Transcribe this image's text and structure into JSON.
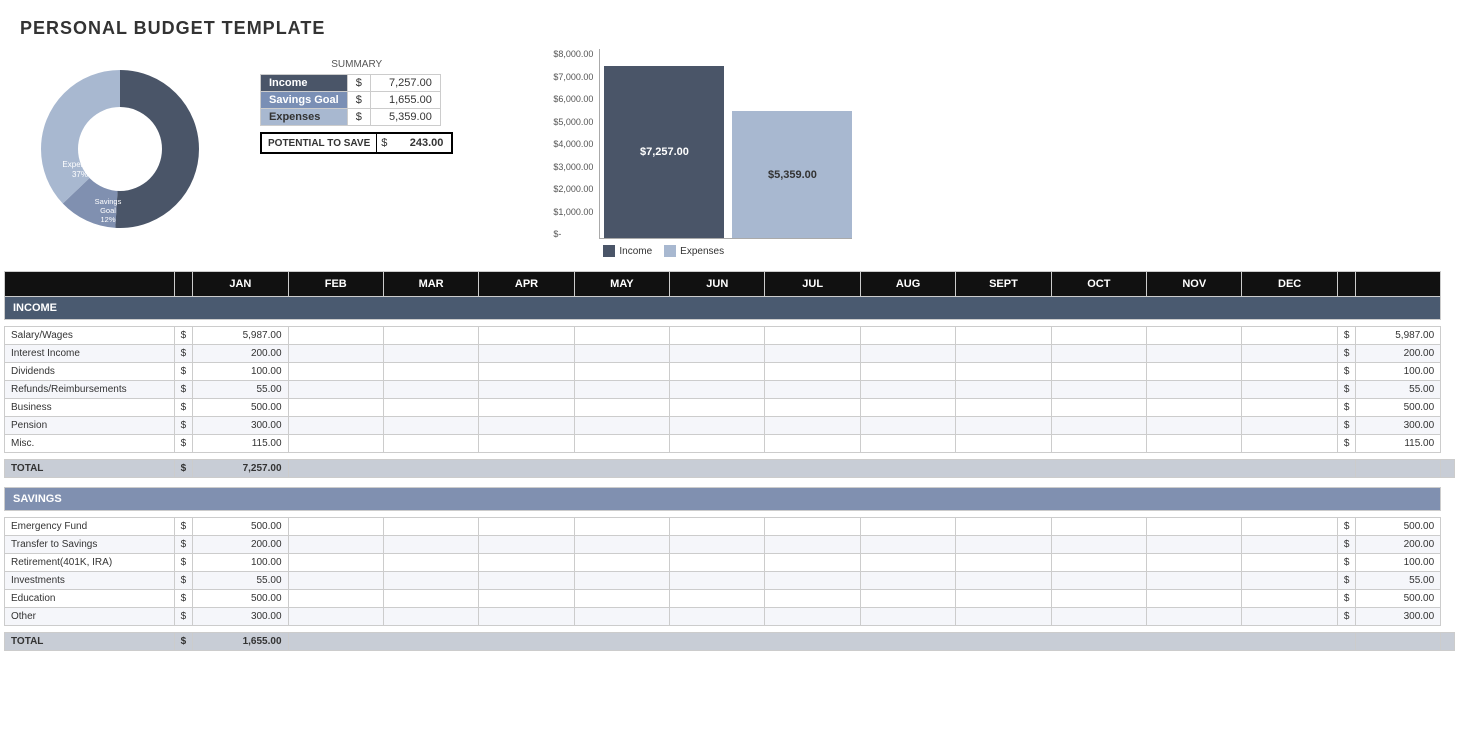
{
  "title": "PERSONAL BUDGET TEMPLATE",
  "summary": {
    "title": "SUMMARY",
    "rows": [
      {
        "label": "Income",
        "dollar": "$",
        "value": "7,257.00",
        "class": "lbl-income"
      },
      {
        "label": "Savings Goal",
        "dollar": "$",
        "value": "1,655.00",
        "class": "lbl-savings"
      },
      {
        "label": "Expenses",
        "dollar": "$",
        "value": "5,359.00",
        "class": "lbl-expenses"
      }
    ],
    "potential_label": "POTENTIAL TO SAVE",
    "potential_dollar": "$",
    "potential_value": "243.00"
  },
  "donut": {
    "segments": [
      {
        "label": "Income",
        "pct": "51%",
        "color": "#4a5568"
      },
      {
        "label": "Expenses",
        "pct": "37%",
        "color": "#a8b8d0"
      },
      {
        "label": "Savings\nGoal",
        "pct": "12%",
        "color": "#8090b0"
      }
    ]
  },
  "bar_chart": {
    "y_labels": [
      "$8,000.00",
      "$7,000.00",
      "$6,000.00",
      "$5,000.00",
      "$4,000.00",
      "$3,000.00",
      "$2,000.00",
      "$1,000.00",
      "$-"
    ],
    "bars": [
      {
        "label": "Income",
        "value": "$7,257.00",
        "amount": 7257,
        "color": "#4a5568"
      },
      {
        "label": "Expenses",
        "value": "$5,359.00",
        "amount": 5359,
        "color": "#a8b8d0"
      }
    ],
    "max": 8000,
    "legend": [
      {
        "label": "Income",
        "color": "#4a5568"
      },
      {
        "label": "Expenses",
        "color": "#a8b8d0"
      }
    ]
  },
  "months": [
    "JAN",
    "FEB",
    "MAR",
    "APR",
    "MAY",
    "JUN",
    "JUL",
    "AUG",
    "SEPT",
    "OCT",
    "NOV",
    "DEC"
  ],
  "income": {
    "section_label": "INCOME",
    "rows": [
      {
        "label": "Salary/Wages",
        "jan_dollar": "$",
        "jan_value": "5,987.00",
        "total_dollar": "$",
        "total_value": "5,987.00"
      },
      {
        "label": "Interest Income",
        "jan_dollar": "$",
        "jan_value": "200.00",
        "total_dollar": "$",
        "total_value": "200.00"
      },
      {
        "label": "Dividends",
        "jan_dollar": "$",
        "jan_value": "100.00",
        "total_dollar": "$",
        "total_value": "100.00"
      },
      {
        "label": "Refunds/Reimbursements",
        "jan_dollar": "$",
        "jan_value": "55.00",
        "total_dollar": "$",
        "total_value": "55.00"
      },
      {
        "label": "Business",
        "jan_dollar": "$",
        "jan_value": "500.00",
        "total_dollar": "$",
        "total_value": "500.00"
      },
      {
        "label": "Pension",
        "jan_dollar": "$",
        "jan_value": "300.00",
        "total_dollar": "$",
        "total_value": "300.00"
      },
      {
        "label": "Misc.",
        "jan_dollar": "$",
        "jan_value": "115.00",
        "total_dollar": "$",
        "total_value": "115.00"
      }
    ],
    "total_label": "TOTAL",
    "total_dollar": "$",
    "total_value": "7,257.00"
  },
  "savings": {
    "section_label": "SAVINGS",
    "rows": [
      {
        "label": "Emergency Fund",
        "jan_dollar": "$",
        "jan_value": "500.00",
        "total_dollar": "$",
        "total_value": "500.00"
      },
      {
        "label": "Transfer to Savings",
        "jan_dollar": "$",
        "jan_value": "200.00",
        "total_dollar": "$",
        "total_value": "200.00"
      },
      {
        "label": "Retirement(401K, IRA)",
        "jan_dollar": "$",
        "jan_value": "100.00",
        "total_dollar": "$",
        "total_value": "100.00"
      },
      {
        "label": "Investments",
        "jan_dollar": "$",
        "jan_value": "55.00",
        "total_dollar": "$",
        "total_value": "55.00"
      },
      {
        "label": "Education",
        "jan_dollar": "$",
        "jan_value": "500.00",
        "total_dollar": "$",
        "total_value": "500.00"
      },
      {
        "label": "Other",
        "jan_dollar": "$",
        "jan_value": "300.00",
        "total_dollar": "$",
        "total_value": "300.00"
      }
    ],
    "total_label": "TOTAL",
    "total_dollar": "$",
    "total_value": "1,655.00"
  }
}
